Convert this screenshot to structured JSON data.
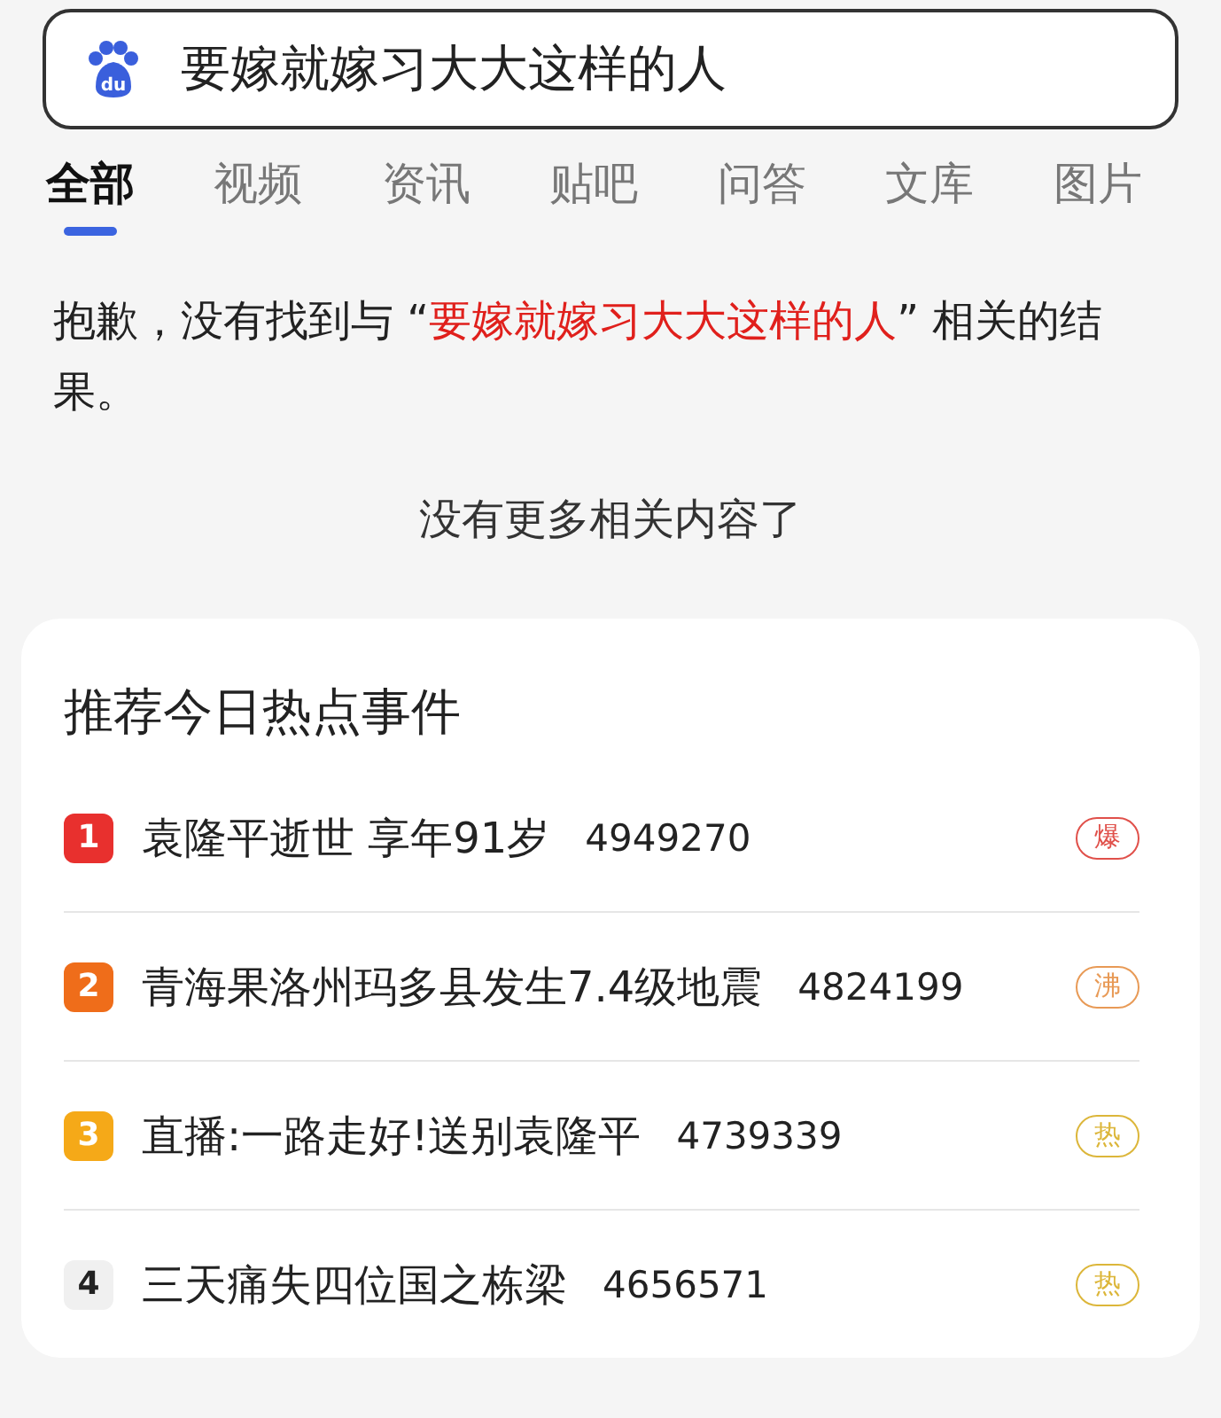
{
  "search": {
    "logo": "du",
    "value": "要嫁就嫁习大大这样的人"
  },
  "tabs": [
    {
      "label": "全部",
      "selected": true
    },
    {
      "label": "视频",
      "selected": false
    },
    {
      "label": "资讯",
      "selected": false
    },
    {
      "label": "贴吧",
      "selected": false
    },
    {
      "label": "问答",
      "selected": false
    },
    {
      "label": "文库",
      "selected": false
    },
    {
      "label": "图片",
      "selected": false
    }
  ],
  "notice": {
    "before": "抱歉，没有找到与 “",
    "query": "要嫁就嫁习大大这样的人",
    "after": "” 相关的结果。"
  },
  "end_note": "没有更多相关内容了",
  "hot": {
    "title": "推荐今日热点事件",
    "items": [
      {
        "rank": "1",
        "color": "#e8302e",
        "title": "袁隆平逝世 享年91岁",
        "count": "4949270",
        "tag": {
          "text": "爆",
          "color": "#e0504a"
        }
      },
      {
        "rank": "2",
        "color": "#ef6d1a",
        "title": "青海果洛州玛多县发生7.4级地震",
        "count": "4824199",
        "tag": {
          "text": "沸",
          "color": "#e89a56"
        }
      },
      {
        "rank": "3",
        "color": "#f5a918",
        "title": "直播:一路走好!送别袁隆平",
        "count": "4739339",
        "tag": {
          "text": "热",
          "color": "#dcb63a"
        }
      },
      {
        "rank": "4",
        "color": "#f0f0f0",
        "title": "三天痛失四位国之栋梁",
        "count": "4656571",
        "tag": {
          "text": "热",
          "color": "#dcb63a"
        }
      }
    ]
  }
}
